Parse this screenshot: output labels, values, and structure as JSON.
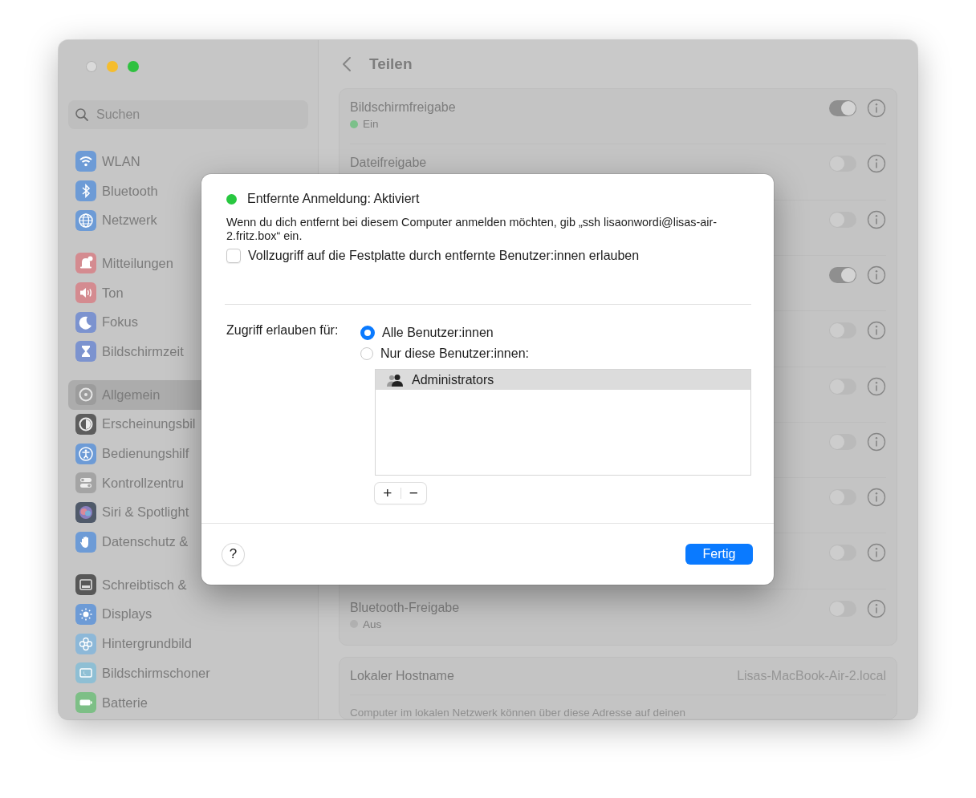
{
  "window": {
    "controls": [
      {
        "kind": "close",
        "disabled": true
      },
      {
        "kind": "minimize",
        "disabled": false
      },
      {
        "kind": "zoom",
        "disabled": false
      }
    ]
  },
  "sidebar": {
    "search": {
      "placeholder": "Suchen"
    },
    "groups": [
      [
        {
          "label": "WLAN",
          "selected": false
        },
        {
          "label": "Bluetooth",
          "selected": false
        },
        {
          "label": "Netzwerk",
          "selected": false
        }
      ],
      [
        {
          "label": "Mitteilungen",
          "selected": false
        },
        {
          "label": "Ton",
          "selected": false
        },
        {
          "label": "Fokus",
          "selected": false
        },
        {
          "label": "Bildschirmzeit",
          "selected": false
        }
      ],
      [
        {
          "label": "Allgemein",
          "selected": true
        },
        {
          "label": "Erscheinungsbil",
          "selected": false
        },
        {
          "label": "Bedienungshilf",
          "selected": false
        },
        {
          "label": "Kontrollzentru",
          "selected": false
        },
        {
          "label": "Siri & Spotlight",
          "selected": false
        },
        {
          "label": "Datenschutz &",
          "selected": false
        }
      ],
      [
        {
          "label": "Schreibtisch &",
          "selected": false
        },
        {
          "label": "Displays",
          "selected": false
        },
        {
          "label": "Hintergrundbild",
          "selected": false
        },
        {
          "label": "Bildschirmschoner",
          "selected": false
        },
        {
          "label": "Batterie",
          "selected": false
        }
      ]
    ]
  },
  "content": {
    "title": "Teilen",
    "services": [
      {
        "label": "Bildschirmfreigabe",
        "status": "Ein",
        "on": true
      },
      {
        "label": "Dateifreigabe",
        "on": false
      },
      {
        "on": false
      },
      {
        "on": true
      },
      {
        "on": false
      },
      {
        "on": false
      },
      {
        "on": false
      },
      {
        "on": false
      },
      {
        "on": false
      },
      {
        "label": "Bluetooth-Freigabe",
        "status": "Aus",
        "on": false
      }
    ],
    "hostname": {
      "label": "Lokaler Hostname",
      "value": "Lisas-MacBook-Air-2.local",
      "description": "Computer im lokalen Netzwerk können über diese Adresse auf deinen"
    }
  },
  "dialog": {
    "status": {
      "text": "Entfernte Anmeldung: Aktiviert",
      "active": true
    },
    "description": "Wenn du dich entfernt bei diesem Computer anmelden möchten, gib „ssh lisaonwordi@lisas-air-2.fritz.box“ ein.",
    "full_disk_access": {
      "label": "Vollzugriff auf die Festplatte durch entfernte Benutzer:innen erlauben",
      "checked": false
    },
    "access": {
      "label": "Zugriff erlauben für:",
      "options": [
        {
          "label": "Alle Benutzer:innen",
          "selected": true
        },
        {
          "label": "Nur diese Benutzer:innen:",
          "selected": false
        }
      ]
    },
    "users": [
      {
        "name": "Administrators",
        "selected": true
      }
    ],
    "add_button": "+",
    "remove_button": "−",
    "help_button": "?",
    "done_button": "Fertig"
  }
}
